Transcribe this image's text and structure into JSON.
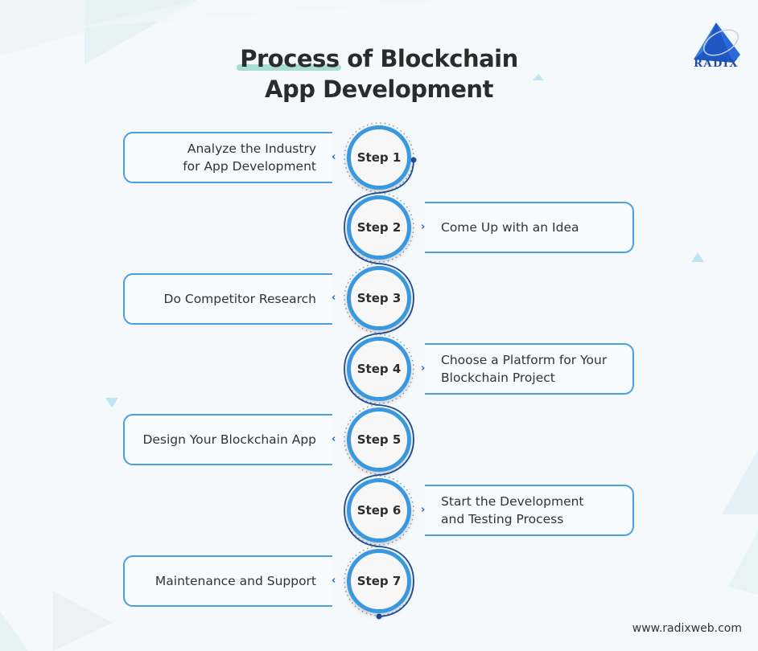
{
  "title": {
    "highlight": "Process",
    "line1_rest": " of Blockchain",
    "line2": "App Development"
  },
  "brand": {
    "logo_text": "RADIX",
    "website": "www.radixweb.com",
    "accent_color": "#3a98de",
    "dark_accent_color": "#1f5fae",
    "highlight_color": "#a8dcd6"
  },
  "steps": [
    {
      "label": "Step 1",
      "text_line1": "Analyze the Industry",
      "text_line2": "for App Development",
      "side": "left"
    },
    {
      "label": "Step 2",
      "text_line1": "Come Up with an Idea",
      "text_line2": "",
      "side": "right"
    },
    {
      "label": "Step 3",
      "text_line1": "Do Competitor Research",
      "text_line2": "",
      "side": "left"
    },
    {
      "label": "Step 4",
      "text_line1": "Choose a Platform for Your",
      "text_line2": "Blockchain Project",
      "side": "right"
    },
    {
      "label": "Step 5",
      "text_line1": "Design Your Blockchain App",
      "text_line2": "",
      "side": "left"
    },
    {
      "label": "Step 6",
      "text_line1": "Start the Development",
      "text_line2": "and Testing Process",
      "side": "right"
    },
    {
      "label": "Step 7",
      "text_line1": "Maintenance and Support",
      "text_line2": "",
      "side": "left"
    }
  ]
}
